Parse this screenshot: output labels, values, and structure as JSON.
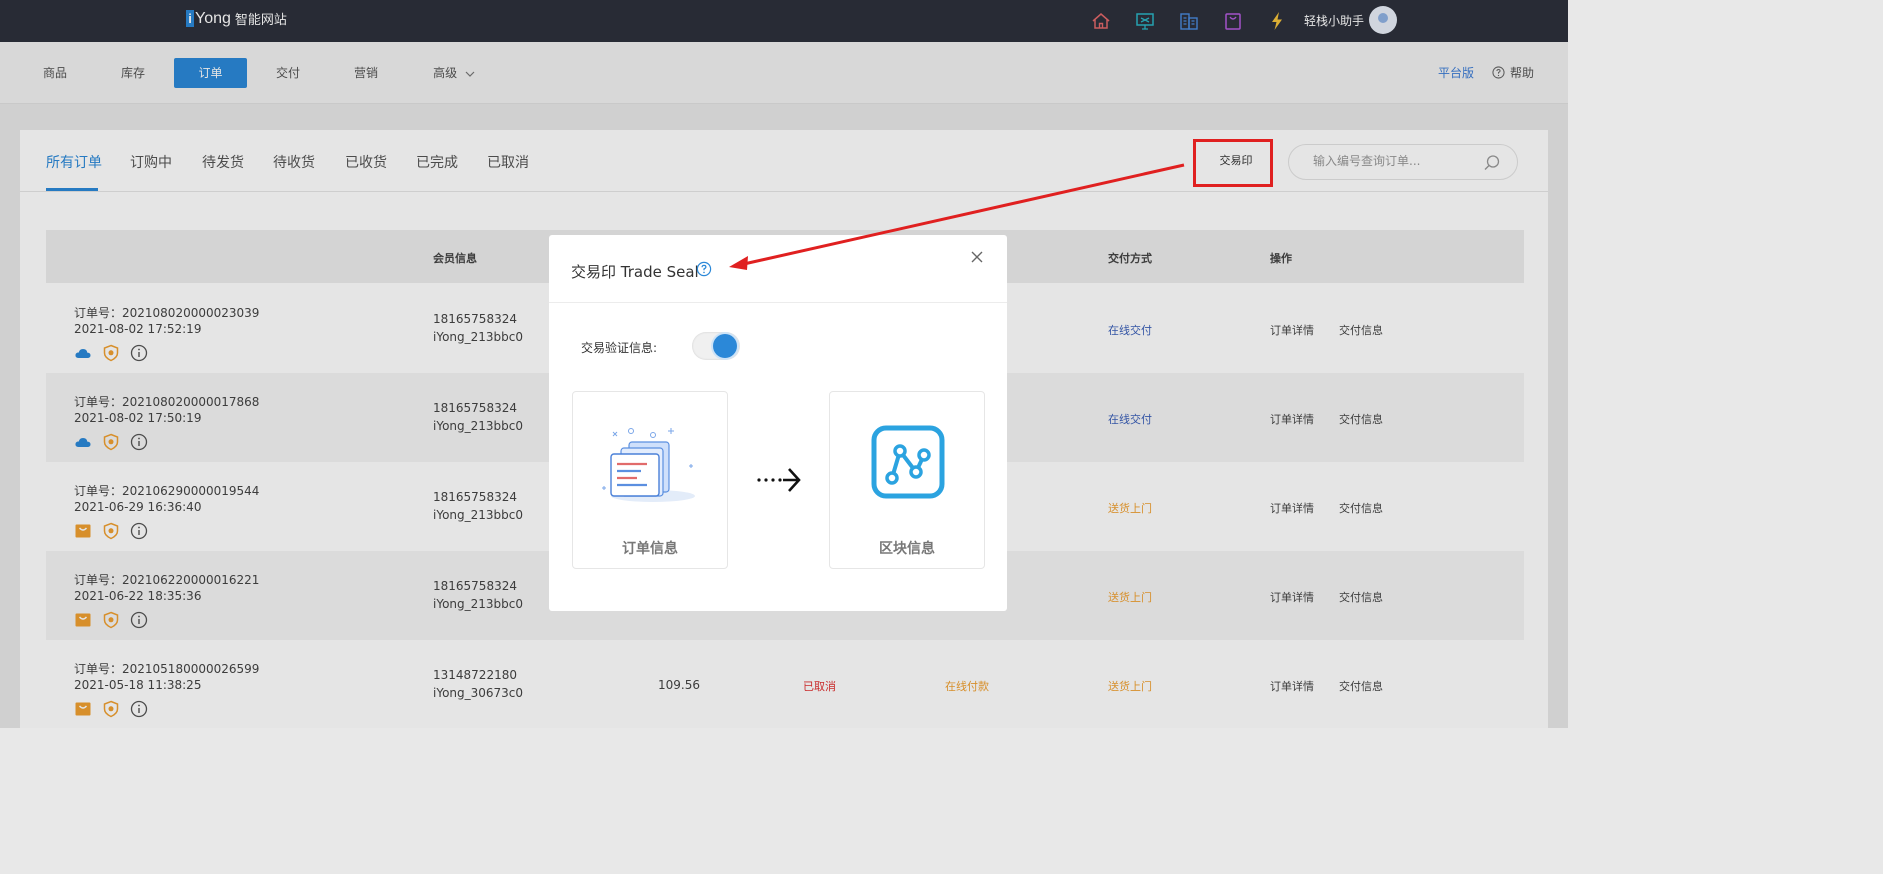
{
  "topbar": {
    "logo_mark": "i",
    "logo_word": "Yong",
    "logo_cn": "智能网站",
    "icons": [
      "home-icon",
      "monitor-icon",
      "building-icon",
      "bag-icon",
      "lightning-icon"
    ],
    "icon_colors": {
      "home": "#e3686a",
      "monitor": "#2bb5c5",
      "building": "#4a8ce0",
      "bag": "#b55de0",
      "lightning": "#f5c33b"
    },
    "assistant_label": "轻栈小助手"
  },
  "nav": {
    "items": [
      {
        "label": "商品"
      },
      {
        "label": "库存"
      },
      {
        "label": "订单",
        "active": true
      },
      {
        "label": "交付"
      },
      {
        "label": "营销"
      },
      {
        "label": "高级"
      }
    ],
    "platform_label": "平台版",
    "help_label": "帮助"
  },
  "tabs": {
    "items": [
      "所有订单",
      "订购中",
      "待发货",
      "待收货",
      "已收货",
      "已完成",
      "已取消"
    ],
    "active_index": 0,
    "seal_button": "交易印",
    "search_placeholder": "输入编号查询订单..."
  },
  "table": {
    "headers": {
      "member": "会员信息",
      "delivery": "交付方式",
      "actions": "操作"
    },
    "rows": [
      {
        "order_no": "订单号：202108020000023039",
        "time": "2021-08-02 17:52:19",
        "phone": "18165758324",
        "user": "iYong_213bbc0",
        "delivery": "在线交付",
        "delivery_color": "#3a5fb8",
        "icon": "cloud"
      },
      {
        "order_no": "订单号：202108020000017868",
        "time": "2021-08-02 17:50:19",
        "phone": "18165758324",
        "user": "iYong_213bbc0",
        "delivery": "在线交付",
        "delivery_color": "#3a5fb8",
        "icon": "cloud"
      },
      {
        "order_no": "订单号：202106290000019544",
        "time": "2021-06-29 16:36:40",
        "phone": "18165758324",
        "user": "iYong_213bbc0",
        "delivery": "送货上门",
        "delivery_color": "#f0a030",
        "icon": "box"
      },
      {
        "order_no": "订单号：202106220000016221",
        "time": "2021-06-22 18:35:36",
        "phone": "18165758324",
        "user": "iYong_213bbc0",
        "delivery": "送货上门",
        "delivery_color": "#f0a030",
        "icon": "box"
      },
      {
        "order_no": "订单号：202105180000026599",
        "time": "2021-05-18 11:38:25",
        "phone": "13148722180",
        "user": "iYong_30673c0",
        "amount": "109.56",
        "status": "已取消",
        "payment": "在线付款",
        "delivery": "送货上门",
        "delivery_color": "#f0a030",
        "icon": "box"
      }
    ],
    "action_detail": "订单详情",
    "action_delivery": "交付信息"
  },
  "modal": {
    "title": "交易印 Trade Seal",
    "verify_label": "交易验证信息:",
    "toggle_on": true,
    "card_order": "订单信息",
    "card_block": "区块信息"
  },
  "colors": {
    "accent": "#2b88d8",
    "highlight": "#e02020",
    "cancelled": "#e03030",
    "payment": "#f0a030"
  }
}
